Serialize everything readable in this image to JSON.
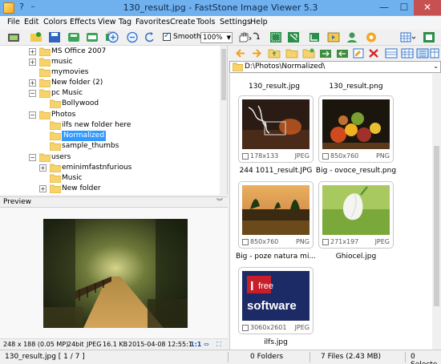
{
  "window": {
    "title": "130_result.jpg  -  FastStone Image Viewer 5.3",
    "help_glyph": "?",
    "dash_glyph": "–",
    "minimize": "—",
    "maximize": "☐",
    "close": "✕"
  },
  "menu": [
    "File",
    "Edit",
    "Colors",
    "Effects",
    "View",
    "Tag",
    "Favorites",
    "Create",
    "Tools",
    "Settings",
    "Help"
  ],
  "toolbar": {
    "smooth_label": "Smooth",
    "zoom_value": "100%",
    "icons": [
      "open-folder-icon",
      "open-file-icon",
      "save-icon",
      "save-as-icon",
      "email-icon",
      "print-icon",
      "zoom-in-icon",
      "zoom-out-icon",
      "rotate-left-icon",
      "rotate-right-icon",
      "hand-tool-icon",
      "acquire-icon",
      "resize-icon",
      "crop-icon",
      "slideshow-icon",
      "settings-icon",
      "layout-icon",
      "fullscreen-icon"
    ]
  },
  "tree": {
    "items": [
      {
        "label": "MS Office 2007",
        "expander": "+",
        "level": 2
      },
      {
        "label": "music",
        "expander": "+",
        "level": 2
      },
      {
        "label": "mymovies",
        "expander": "",
        "level": 2
      },
      {
        "label": "New folder (2)",
        "expander": "+",
        "level": 2
      },
      {
        "label": "pc Music",
        "expander": "−",
        "level": 2
      },
      {
        "label": "Bollywood",
        "expander": "",
        "level": 3
      },
      {
        "label": "Photos",
        "expander": "−",
        "level": 2
      },
      {
        "label": "ilfs new folder here",
        "expander": "",
        "level": 3
      },
      {
        "label": "Normalized",
        "expander": "",
        "level": 3,
        "selected": true
      },
      {
        "label": "sample_thumbs",
        "expander": "",
        "level": 3
      },
      {
        "label": "users",
        "expander": "−",
        "level": 2
      },
      {
        "label": "eminimfastnfurious",
        "expander": "+",
        "level": 3
      },
      {
        "label": "Music",
        "expander": "",
        "level": 3
      },
      {
        "label": "New folder",
        "expander": "+",
        "level": 3
      }
    ]
  },
  "preview": {
    "header": "Preview",
    "collapse_glyph": "︾",
    "info": {
      "dimensions": "248 x 188 (0.05 MP)",
      "bit_depth": "24bit",
      "format": "JPEG",
      "size": "16.1 KB",
      "date": "2015-04-08 12:55:1",
      "ratio": "1:1"
    }
  },
  "address": {
    "path": "D:\\Photos\\Normalized\\"
  },
  "browser": {
    "partial_captions": [
      "130_result.jpg",
      "130_result.png"
    ],
    "thumbs": [
      {
        "caption": "244 1011_result.JPG",
        "dims": "178x133",
        "format": "JPEG"
      },
      {
        "caption": "Big - ovoce_result.png",
        "dims": "850x760",
        "format": "PNG"
      },
      {
        "caption": "Big - poze natura mi...",
        "dims": "850x760",
        "format": "PNG"
      },
      {
        "caption": "Ghiocel.jpg",
        "dims": "271x197",
        "format": "JPEG"
      },
      {
        "caption": "ilfs.jpg",
        "dims": "3060x2601",
        "format": "JPEG"
      }
    ],
    "ilfs_logo_text": "I free software"
  },
  "status": {
    "file": "130_result.jpg [ 1 / 7 ]",
    "folders": "0 Folders",
    "files": "7 Files (2.43 MB)",
    "selected": "0 Selecte"
  },
  "colors": {
    "titlebar": "#6fb1ee",
    "selection": "#3399ff",
    "close": "#c75050"
  }
}
